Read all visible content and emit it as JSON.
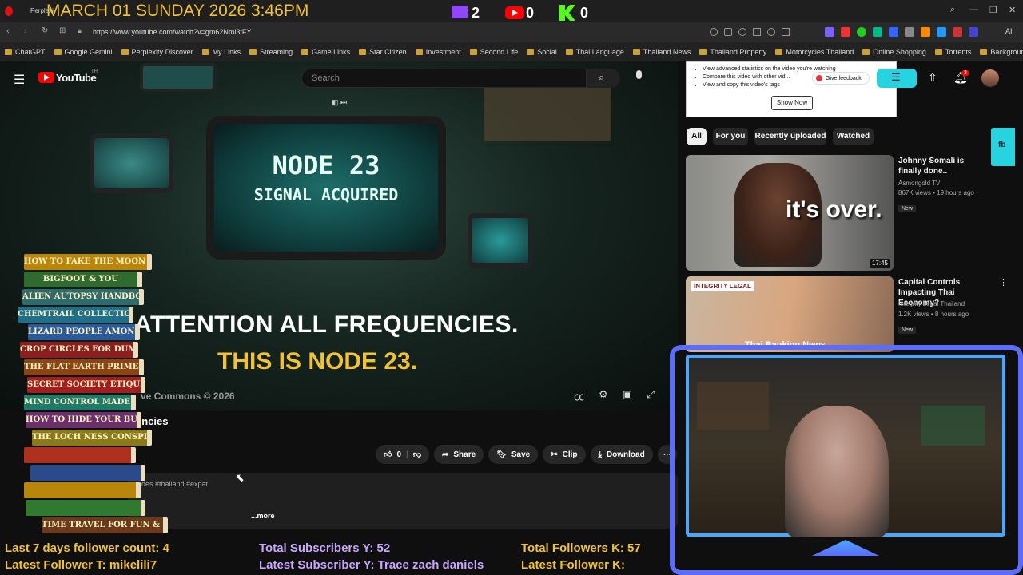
{
  "stream_overlay": {
    "clock": "MARCH 01 SUNDAY 2026 3:46PM",
    "twitch_count": "2",
    "youtube_count": "0",
    "kick_count": "0"
  },
  "browser": {
    "tab_label": "Perplexi",
    "url": "https://www.youtube.com/watch?v=gm62Nml3tFY",
    "bookmarks": [
      "ChatGPT",
      "Google Gemini",
      "Perplexity Discover",
      "My Links",
      "Streaming",
      "Game Links",
      "Star Citizen",
      "Investment",
      "Second Life",
      "Social",
      "Thai Language",
      "Thailand News",
      "Thailand Property",
      "Motorcycles Thailand",
      "Online Shopping",
      "Torrents",
      "Background Remover"
    ]
  },
  "youtube": {
    "logo": "YouTube",
    "logo_country": "TH",
    "search_placeholder": "Search",
    "notification_count": "3",
    "promo": {
      "lines": [
        "View advanced statistics on the video you're watching",
        "Compare this video with other vid...",
        "View and copy this video's tags"
      ],
      "feedback_label": "Give feedback",
      "show_now": "Show Now"
    },
    "video": {
      "screen_line1": "NODE 23",
      "screen_line2": "SIGNAL ACQUIRED",
      "caption1": "ATTENTION ALL FREQUENCIES.",
      "caption2": "THIS IS NODE 23.",
      "copyright": "ve Commons © 2026",
      "title_fragment": "encies",
      "hashtags": "rdes #thailand #expat",
      "more": "...more"
    },
    "actions": {
      "like_count": "0",
      "share": "Share",
      "save": "Save",
      "clip": "Clip",
      "download": "Download"
    },
    "chips": [
      "All",
      "For you",
      "Recently uploaded",
      "Watched"
    ],
    "recommendations": [
      {
        "title": "Johnny Somali is finally done..",
        "channel": "Asmongold TV",
        "views": "867K views • 19 hours ago",
        "badge": "New",
        "duration": "17:45",
        "thumb_text": "it's over."
      },
      {
        "title": "Capital Controls Impacting Thai Economy?",
        "channel": "Integrity Legal Thailand",
        "views": "1.2K views • 8 hours ago",
        "badge": "New",
        "thumb_text": "INTEGRITY LEGAL",
        "thumb_text2": "Thai Banking News"
      }
    ]
  },
  "books": [
    "HOW TO FAKE THE MOON LANDING",
    "BIGFOOT & YOU",
    "ALIEN AUTOPSY HANDBOOK",
    "CHEMTRAIL COLLECTION GUIDE",
    "LIZARD PEOPLE AMONG US",
    "CROP CIRCLES FOR DUMMIES",
    "THE FLAT EARTH PRIMER",
    "SECRET SOCIETY ETIQUETTE",
    "MIND CONTROL MADE EASY",
    "HOW TO HIDE YOUR BUNKER",
    "THE LOCH NESS CONSPIRACY",
    "",
    "",
    "",
    "",
    "TIME TRAVEL FOR FUN & PROFIT"
  ],
  "stats": {
    "followers_7d": "Last 7 days follower count: 4",
    "latest_follower_t": "Latest Follower T: mikelili7",
    "subs_y": "Total Subscribers Y: 52",
    "latest_sub_y": "Latest Subscriber Y: Trace zach daniels",
    "followers_k": "Total Followers K: 57",
    "latest_follower_k": "Latest Follower K:"
  },
  "colors": {
    "accent_red": "#ff0000",
    "twitch": "#9146ff",
    "kick": "#53fc18",
    "overlay_yellow": "#f1c232",
    "frame_blue": "#5c6cff"
  }
}
